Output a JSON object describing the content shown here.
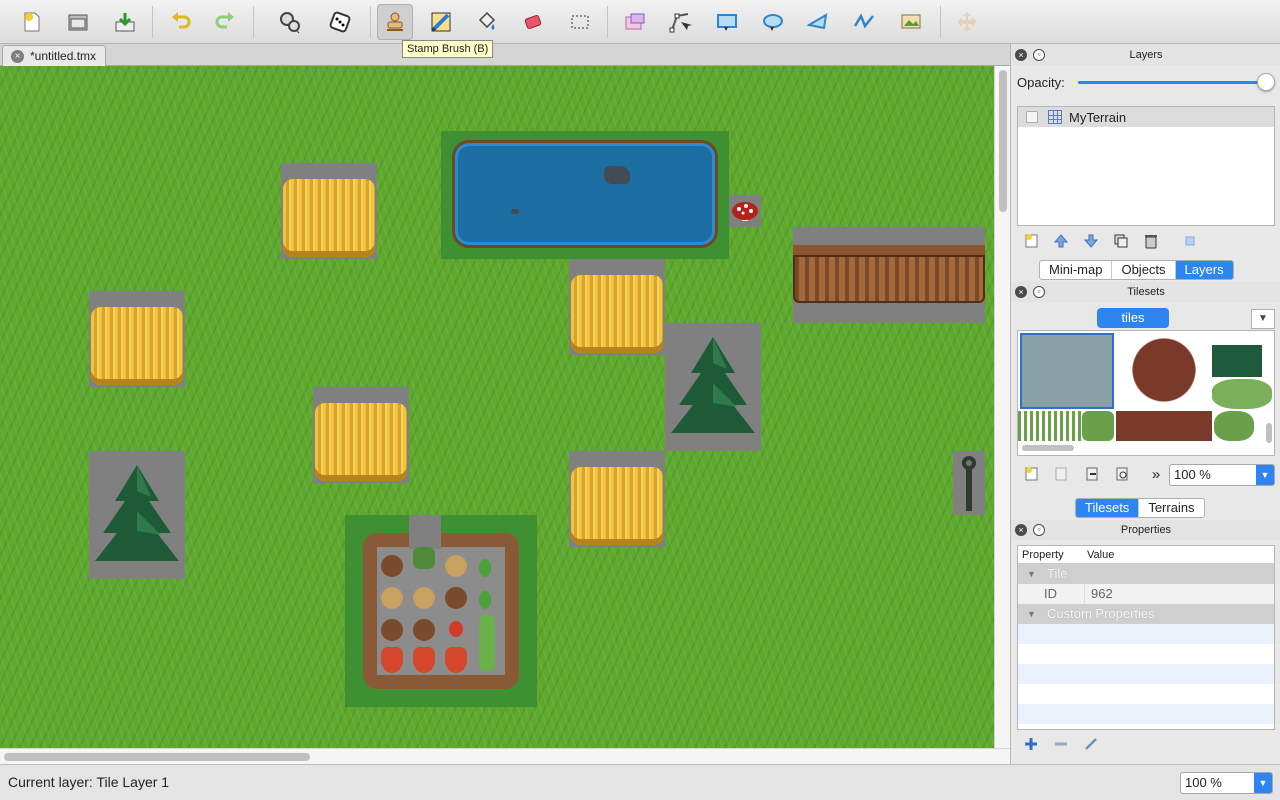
{
  "toolbar": {
    "buttons": [
      "new-map-icon",
      "open-icon",
      "save-icon",
      "undo-icon",
      "redo-icon",
      "commands-icon",
      "random-mode-icon",
      "stamp-brush-icon",
      "terrain-brush-icon",
      "bucket-fill-icon",
      "eraser-icon",
      "rectangular-select-icon",
      "select-objects-icon",
      "edit-polygons-icon",
      "insert-rectangle-icon",
      "insert-ellipse-icon",
      "insert-polygon-icon",
      "insert-polyline-icon",
      "insert-tile-icon",
      "insert-template-icon"
    ],
    "active": "stamp-brush-icon",
    "tooltip": "Stamp Brush (B)"
  },
  "document": {
    "tab_label": "*untitled.tmx"
  },
  "status": {
    "text": "Current layer: Tile Layer 1",
    "zoom": "100 %"
  },
  "layers_panel": {
    "title": "Layers",
    "opacity_label": "Opacity:",
    "opacity": 1.0,
    "layers": [
      {
        "name": "MyTerrain",
        "visible": false
      }
    ]
  },
  "dock_tabs": {
    "items": [
      "Mini-map",
      "Objects",
      "Layers"
    ],
    "active": "Layers"
  },
  "tilesets_panel": {
    "title": "Tilesets",
    "active_tileset": "tiles",
    "zoom": "100 %",
    "bottom_tabs": [
      "Tilesets",
      "Terrains"
    ],
    "active_bottom_tab": "Tilesets"
  },
  "properties_panel": {
    "title": "Properties",
    "columns": [
      "Property",
      "Value"
    ],
    "groups": [
      {
        "name": "Tile",
        "rows": [
          {
            "key": "ID",
            "value": "962"
          }
        ]
      },
      {
        "name": "Custom Properties",
        "rows": []
      }
    ]
  },
  "colors": {
    "accent": "#2f85f0",
    "grass": "#5ea82e",
    "water": "#1c6ea3",
    "empty_tile": "#808080"
  }
}
